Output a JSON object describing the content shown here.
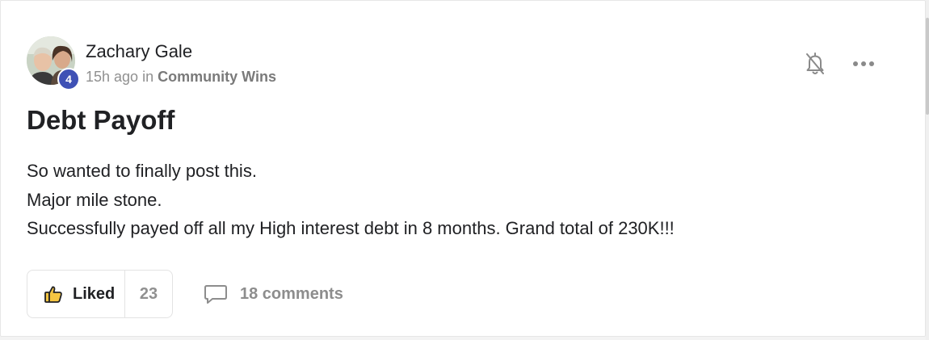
{
  "post": {
    "author": {
      "name": "Zachary Gale",
      "level": "4",
      "time_ago": "15h ago",
      "in_label": "in",
      "community": "Community Wins"
    },
    "title": "Debt Payoff",
    "body_lines": [
      "So wanted to finally post this.",
      "Major mile stone.",
      "Successfully payed off all my High interest debt in 8 months. Grand total of 230K!!!"
    ],
    "like": {
      "label": "Liked",
      "count": "23",
      "icon": "thumbs-up-icon"
    },
    "comments": {
      "label": "18 comments",
      "icon": "comment-icon"
    },
    "actions": {
      "notify_icon": "bell-off-icon",
      "more_icon": "more-horizontal-icon"
    }
  },
  "colors": {
    "badge": "#3f51b5",
    "text": "#202124",
    "muted": "#909090",
    "like_icon_fill": "#f5c542"
  }
}
